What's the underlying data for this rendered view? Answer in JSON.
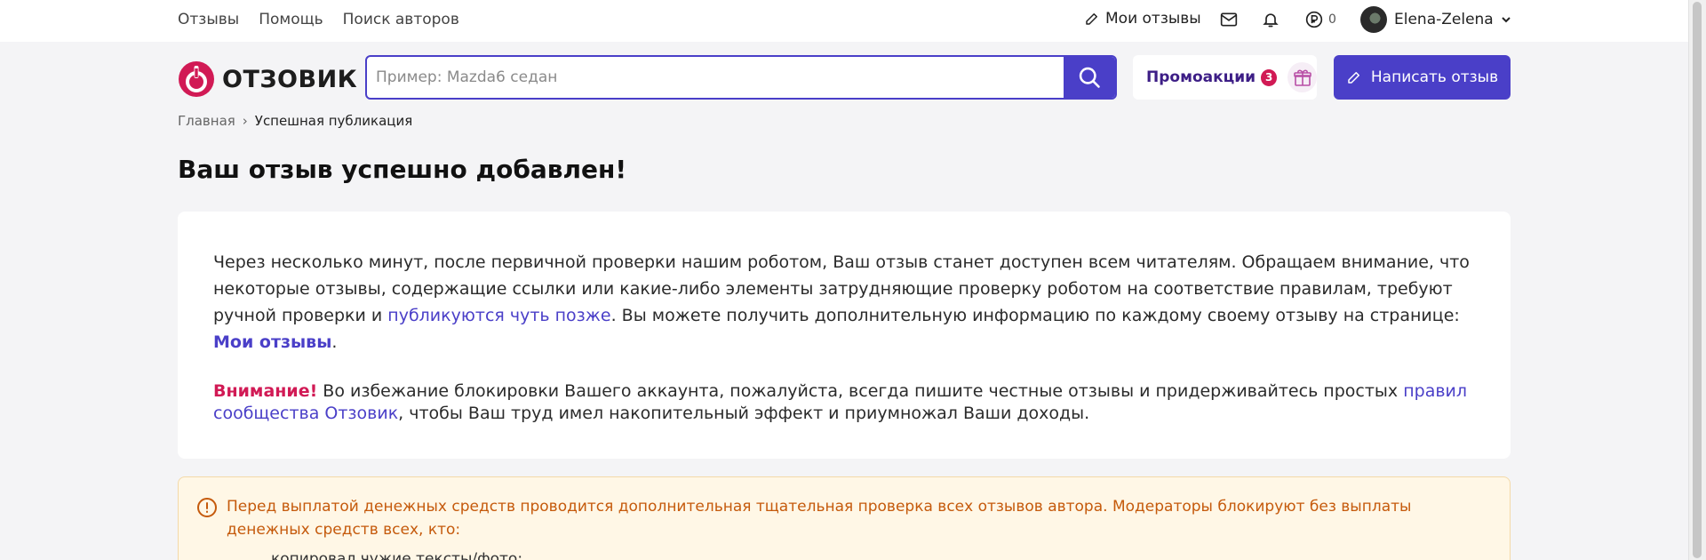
{
  "topnav": {
    "items": [
      "Отзывы",
      "Помощь",
      "Поиск авторов"
    ]
  },
  "topright": {
    "my_reviews": "Мои отзывы",
    "coins": "0",
    "username": "Elena-Zelena"
  },
  "header": {
    "logo_text": "ОТЗОВИК",
    "search_placeholder": "Пример: Mazda6 седан",
    "promo_label": "Промоакции",
    "promo_count": "3",
    "write_label": "Написать отзыв"
  },
  "breadcrumb": {
    "home": "Главная",
    "separator": "›",
    "current": "Успешная публикация"
  },
  "page_title": "Ваш отзыв успешно добавлен!",
  "card": {
    "p1_part1": "Через несколько минут, после первичной проверки нашим роботом, Ваш отзыв станет доступен всем читателям. Обращаем внимание, что некоторые отзывы, содержащие ссылки или какие-либо элементы затрудняющие проверку роботом на соответствие правилам, требуют ручной проверки и ",
    "p1_link": "публикуются чуть позже",
    "p1_part2": ". Вы можете получить дополнительную информацию по каждому своему отзыву на странице: ",
    "p1_link2": "Мои отзывы",
    "p1_end": ".",
    "p2_warning": "Внимание!",
    "p2_part1": " Во избежание блокировки Вашего аккаунта, пожалуйста, всегда пишите честные отзывы и придерживайтесь простых ",
    "p2_link": "правил сообщества Отзовик",
    "p2_part2": ", чтобы Ваш труд имел накопительный эффект и приумножал Ваши доходы."
  },
  "alert": {
    "text": "Перед выплатой денежных средств проводится дополнительная тщательная проверка всех отзывов автора. Модераторы блокируют без выплаты денежных средств всех, кто:",
    "first_item": "копировал чужие тексты/фото;"
  },
  "colors": {
    "accent": "#4a3fc8",
    "brand_red": "#d11a55",
    "alert_text": "#c55a0c",
    "alert_bg": "#fff7e6"
  }
}
